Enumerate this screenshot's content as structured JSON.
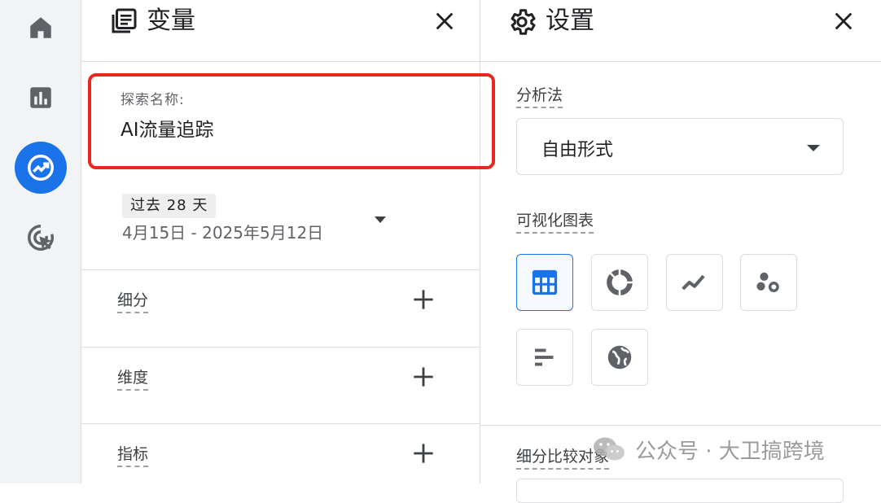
{
  "nav": {
    "items": [
      {
        "id": "home",
        "icon": "home-icon",
        "active": false
      },
      {
        "id": "reports",
        "icon": "bar-chart-icon",
        "active": false
      },
      {
        "id": "explore",
        "icon": "explore-trend-icon",
        "active": true
      },
      {
        "id": "advertising",
        "icon": "ad-target-icon",
        "active": false
      }
    ]
  },
  "variables": {
    "title": "变量",
    "title_icon": "variables-icon",
    "close_icon": "close-icon",
    "exploration_name_label": "探索名称:",
    "exploration_name_value": "AI流量追踪",
    "date_chip": "过去 28 天",
    "date_range": "4月15日 - 2025年5月12日",
    "sections": [
      {
        "label": "细分",
        "icon": "plus-icon"
      },
      {
        "label": "维度",
        "icon": "plus-icon"
      },
      {
        "label": "指标",
        "icon": "plus-icon"
      }
    ]
  },
  "settings": {
    "title": "设置",
    "title_icon": "gear-icon",
    "close_icon": "close-icon",
    "technique_label": "分析法",
    "technique_value": "自由形式",
    "visualization_label": "可视化图表",
    "visualizations": [
      {
        "icon": "table-icon",
        "selected": true
      },
      {
        "icon": "donut-chart-icon",
        "selected": false
      },
      {
        "icon": "line-chart-icon",
        "selected": false
      },
      {
        "icon": "scatter-plot-icon",
        "selected": false
      },
      {
        "icon": "bar-chart-horizontal-icon",
        "selected": false
      },
      {
        "icon": "globe-icon",
        "selected": false
      }
    ],
    "segment_compare_label": "细分比较对象"
  },
  "watermark": {
    "text": "公众号 · 大卫搞跨境",
    "icon": "wechat-icon"
  },
  "colors": {
    "accent": "#1a73e8",
    "highlight": "#e8271f",
    "icon": "#5f6368"
  }
}
